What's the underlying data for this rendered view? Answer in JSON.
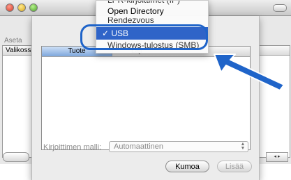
{
  "background_window": {
    "toolbar_label": "Aseta",
    "list_column": "Valikoss",
    "scroll_right_icon": "◂ ▸"
  },
  "sheet": {
    "table": {
      "columns": [
        "Tuote",
        "Laji"
      ]
    },
    "printer_model": {
      "label": "Kirjoittimen malli:",
      "value": "Automaattinen"
    },
    "buttons": {
      "cancel": "Kumoa",
      "add": "Lisää"
    }
  },
  "menu": {
    "items": [
      {
        "label": "LPR-kirjoittimet (IP)",
        "state": "partially-visible"
      },
      {
        "label": "Open Directory",
        "state": "normal"
      },
      {
        "label": "Rendezvous",
        "state": "partially-visible"
      },
      {
        "label": "USB",
        "state": "selected",
        "check": "✓"
      },
      {
        "label": "Windows-tulostus (SMB)",
        "state": "partially-visible"
      }
    ]
  },
  "colors": {
    "accent": "#2f64c8",
    "annotation": "#1f64c9"
  },
  "icons": {
    "close": "red-close-icon",
    "minimize": "yellow-minimize-icon",
    "zoom": "green-zoom-icon",
    "toolbar_toggle": "toolbar-pill-icon",
    "annotation_arrow": "arrow-icon"
  }
}
